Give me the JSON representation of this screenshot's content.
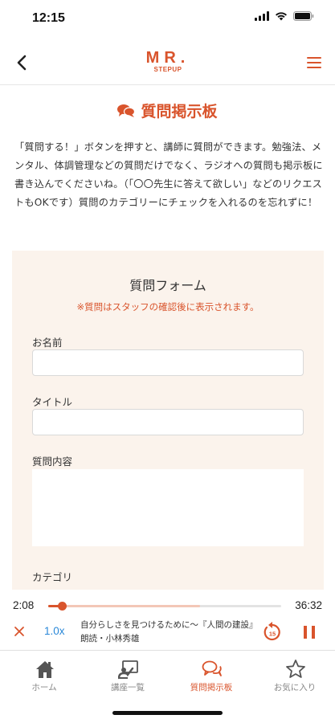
{
  "status_bar": {
    "time": "12:15"
  },
  "header": {
    "logo_main": "MR.",
    "logo_sub": "STEPUP"
  },
  "page": {
    "title": "質問掲示板",
    "intro": "「質問する！」ボタンを押すと、講師に質問ができます。勉強法、メンタル、体調管理などの質問だけでなく、ラジオへの質問も掲示板に書き込んでくださいね。（「〇〇先生に答えて欲しい」などのリクエストもOKです）質問のカテゴリーにチェックを入れるのを忘れずに！"
  },
  "form": {
    "title": "質問フォーム",
    "note": "※質問はスタッフの確認後に表示されます。",
    "name_label": "お名前",
    "name_value": "",
    "title_label": "タイトル",
    "title_value": "",
    "content_label": "質問内容",
    "content_value": "",
    "category_label": "カテゴリ"
  },
  "player": {
    "elapsed": "2:08",
    "total": "36:32",
    "progress": 0.058,
    "buffered": 0.65,
    "speed": "1.0x",
    "track_title": "自分らしさを見つけるために～『人間の建設』朗読・小林秀雄",
    "rewind_seconds": "15"
  },
  "tabs": [
    {
      "label": "ホーム",
      "icon": "home-icon",
      "active": false
    },
    {
      "label": "講座一覧",
      "icon": "lecture-list-icon",
      "active": false
    },
    {
      "label": "質問掲示板",
      "icon": "chat-bubbles-icon",
      "active": true
    },
    {
      "label": "お気に入り",
      "icon": "star-icon",
      "active": false
    }
  ],
  "colors": {
    "accent": "#d9542c",
    "form_background": "#fbf3ec",
    "speed_blue": "#2a88d8"
  }
}
